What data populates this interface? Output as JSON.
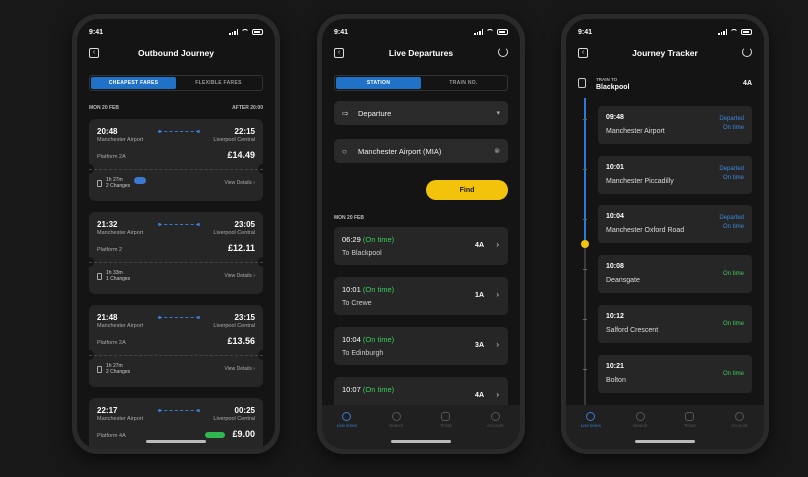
{
  "status_time": "9:41",
  "tabs": [
    {
      "label": "Live times",
      "icon": "clock-icon"
    },
    {
      "label": "Search",
      "icon": "search-icon"
    },
    {
      "label": "Ticket",
      "icon": "ticket-icon"
    },
    {
      "label": "Account",
      "icon": "account-icon"
    }
  ],
  "screen1": {
    "title": "Outbound Journey",
    "segments": [
      "CHEAPEST FARES",
      "FLEXIBLE FARES"
    ],
    "date": "MON 20 FEB",
    "after": "AFTER 20:00",
    "journeys": [
      {
        "dep": "20:48",
        "arr": "22:15",
        "from": "Manchester Airport",
        "to": "Liverpool Central",
        "platform": "Platform 2A",
        "price": "£14.49",
        "duration": "1h 27m",
        "changes": "2 Changes",
        "details": "View Details"
      },
      {
        "dep": "21:32",
        "arr": "23:05",
        "from": "Manchester Airport",
        "to": "Liverpool Central",
        "platform": "Platform 2",
        "price": "£12.11",
        "duration": "1h 33m",
        "changes": "1 Changes",
        "details": "View Details"
      },
      {
        "dep": "21:48",
        "arr": "23:15",
        "from": "Manchester Airport",
        "to": "Liverpool Central",
        "platform": "Platform 2A",
        "price": "£13.56",
        "duration": "1h 27m",
        "changes": "2 Changes",
        "details": "View Details"
      },
      {
        "dep": "22:17",
        "arr": "00:25",
        "from": "Manchester Airport",
        "to": "Liverpool Central",
        "platform": "Platform 4A",
        "price": "£9.00"
      }
    ]
  },
  "screen2": {
    "title": "Live Departures",
    "segments": [
      "STATION",
      "TRAIN NO."
    ],
    "departure_label": "Departure",
    "station_value": "Manchester Airport (MIA)",
    "find_label": "Find",
    "date": "MON 20 FEB",
    "departures": [
      {
        "time": "06:29",
        "status": "(On time)",
        "to": "To  Blackpool",
        "platform": "4A"
      },
      {
        "time": "10:01",
        "status": "(On time)",
        "to": "To  Crewe",
        "platform": "1A"
      },
      {
        "time": "10:04",
        "status": "(On time)",
        "to": "To  Edinburgh",
        "platform": "3A"
      },
      {
        "time": "10:07",
        "status": "(On time)",
        "to": "",
        "platform": "4A"
      }
    ]
  },
  "screen3": {
    "title": "Journey Tracker",
    "train_to_label": "TRAIN TO",
    "destination": "Blackpool",
    "platform": "4A",
    "stops": [
      {
        "time": "09:48",
        "name": "Manchester Airport",
        "status1": "Departed",
        "status2": "On time"
      },
      {
        "time": "10:01",
        "name": "Manchester Piccadilly",
        "status1": "Departed",
        "status2": "On time"
      },
      {
        "time": "10:04",
        "name": "Manchester Oxford Road",
        "status1": "Departed",
        "status2": "On time"
      },
      {
        "time": "10:08",
        "name": "Deansgate",
        "status1": "On time"
      },
      {
        "time": "10:12",
        "name": "Salford Crescent",
        "status1": "On time"
      },
      {
        "time": "10:21",
        "name": "Bolton",
        "status1": "On time"
      }
    ]
  },
  "colors": {
    "accent": "#1f72c8",
    "find": "#f3c20a",
    "ontime": "#3ccd5e"
  }
}
